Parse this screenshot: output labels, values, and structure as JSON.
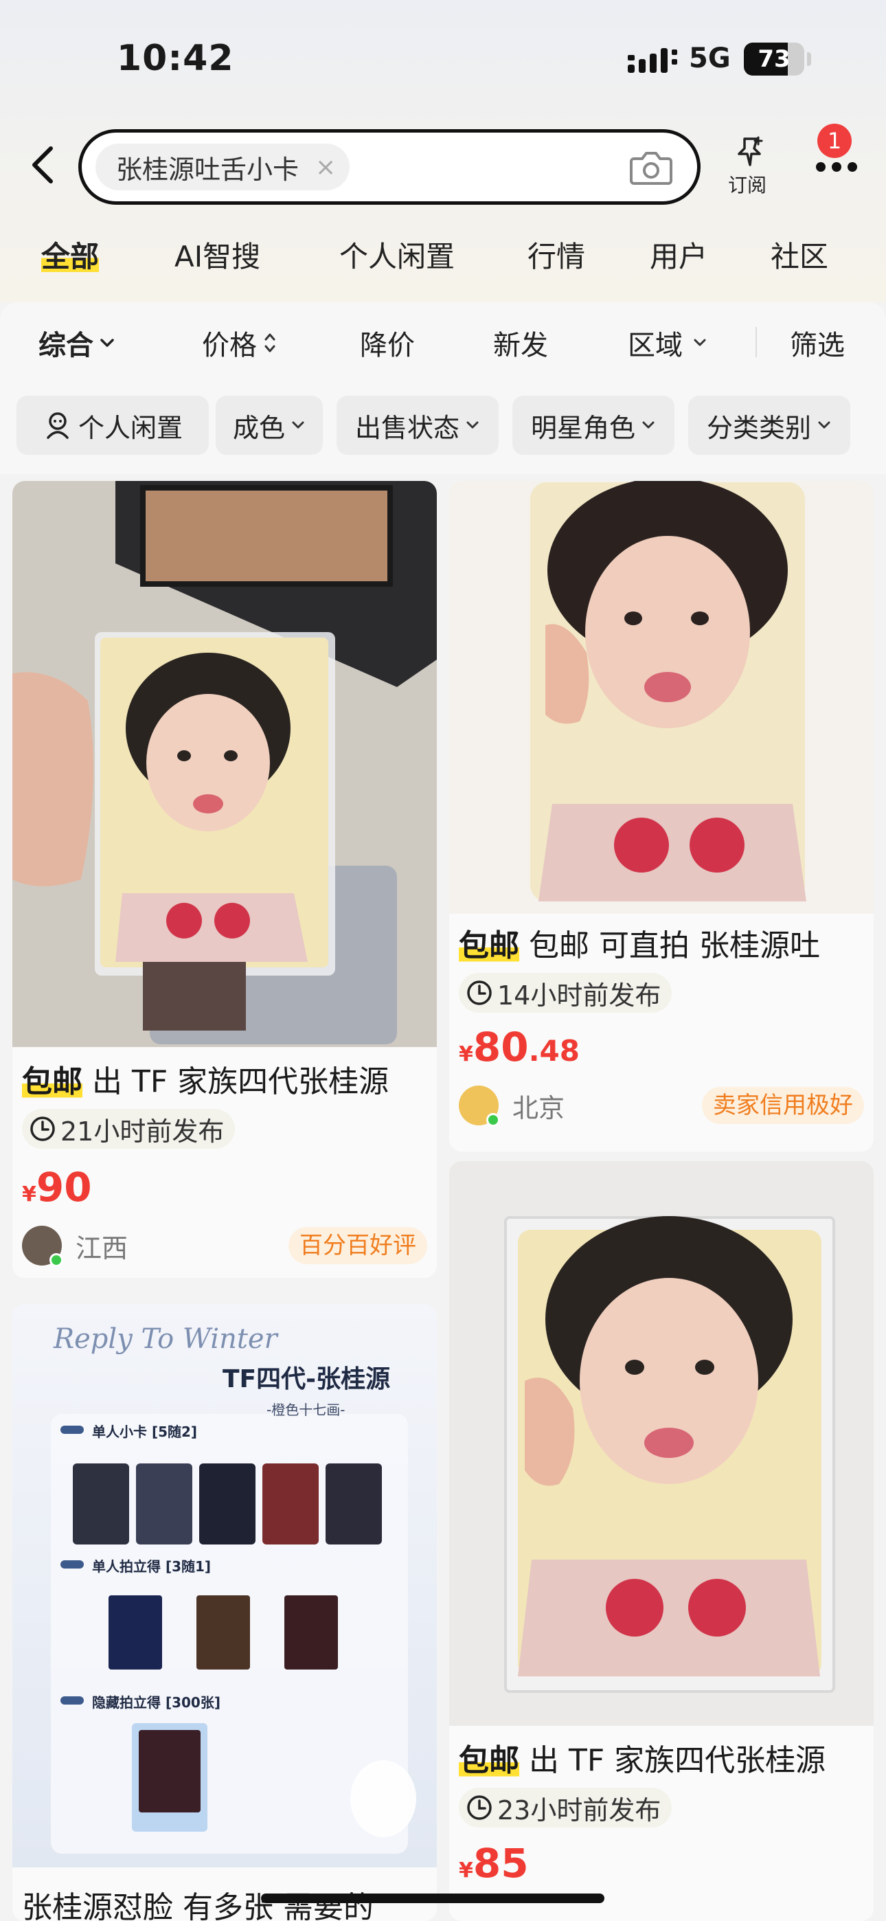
{
  "status_bar": {
    "time": "10:42",
    "network": "5G",
    "battery": "73",
    "battery_level": 0.73
  },
  "search": {
    "query": "张桂源吐舌小卡",
    "clear_symbol": "×"
  },
  "header": {
    "subscribe_label": "订阅",
    "notification_count": "1"
  },
  "tabs": [
    {
      "label": "全部",
      "active": true
    },
    {
      "label": "AI智搜"
    },
    {
      "label": "个人闲置"
    },
    {
      "label": "行情"
    },
    {
      "label": "用户"
    },
    {
      "label": "社区"
    }
  ],
  "sort_bar": {
    "comprehensive": "综合",
    "price": "价格",
    "price_drop": "降价",
    "new": "新发",
    "region": "区域",
    "filter": "筛选"
  },
  "filters": [
    "个人闲置",
    "成色",
    "出售状态",
    "明星角色",
    "分类类别"
  ],
  "listings": [
    {
      "tag": "包邮",
      "title": " 出 TF 家族四代张桂源",
      "time": "21小时前发布",
      "price_symbol": "¥",
      "price_integer": "90",
      "price_decimal": "",
      "location": "江西",
      "badge": "百分百好评"
    },
    {
      "tag": "包邮",
      "title": " 包邮 可直拍 张桂源吐",
      "time": "14小时前发布",
      "price_symbol": "¥",
      "price_integer": "80",
      "price_decimal": ".48",
      "location": "北京",
      "badge": "卖家信用极好"
    },
    {
      "tag": "包邮",
      "title": " 出 TF 家族四代张桂源",
      "time": "23小时前发布",
      "price_symbol": "¥",
      "price_integer": "85",
      "price_decimal": ""
    },
    {
      "title": "张桂源怼脸 有多张 需要的",
      "poster": {
        "script": "Reply To Winter",
        "heading": "TF四代-张桂源",
        "subheading": "-橙色十七画-",
        "section1": "单人小卡 [5随2]",
        "section2": "单人拍立得 [3随1]",
        "section3": "隐藏拍立得 [300张]"
      }
    }
  ],
  "colors": {
    "accent_yellow": "#ffe033",
    "price_red": "#ef3b33",
    "badge_orange": "#f07d1e",
    "online_green": "#3bc94c"
  }
}
